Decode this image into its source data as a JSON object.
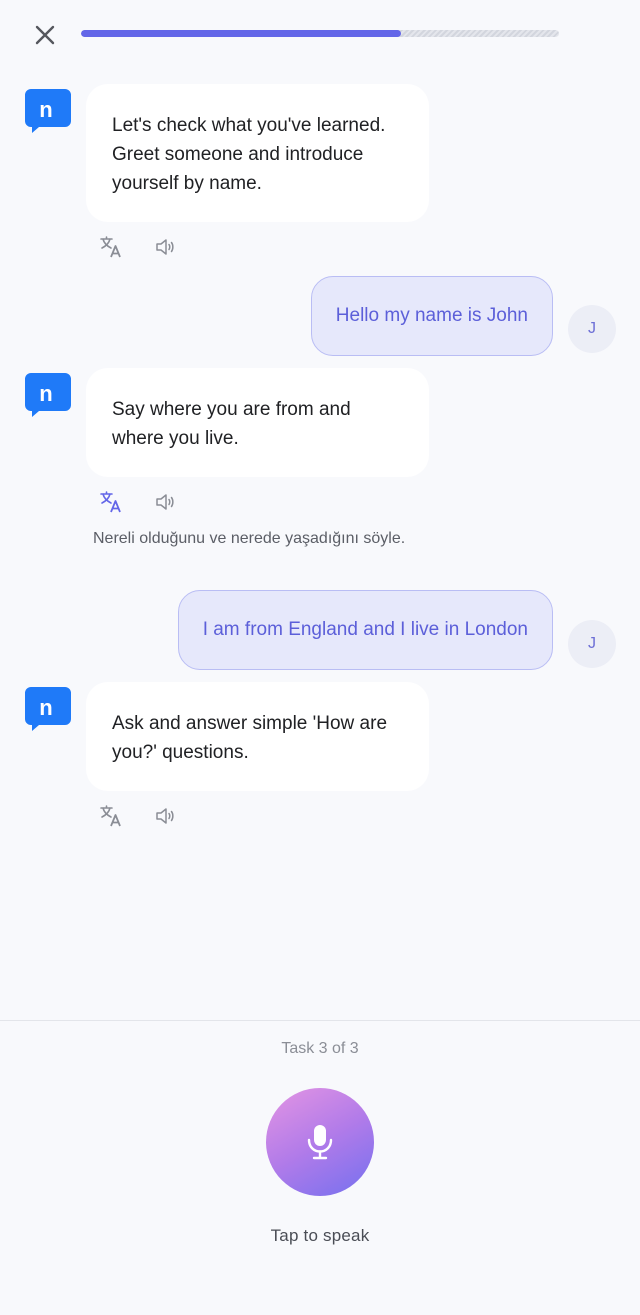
{
  "header": {
    "close_icon": "close-icon",
    "progress": 0.67
  },
  "conversation": {
    "bot_messages": [
      {
        "text": "Let's check what you've learned. Greet someone and introduce yourself by name.",
        "avatar_letter": "n",
        "translation": ""
      },
      {
        "text": "Say where you are from and where you live.",
        "avatar_letter": "n",
        "translation": "Nereli olduğunu ve nerede yaşadığını söyle."
      },
      {
        "text": "Ask and answer simple 'How are you?' questions.",
        "avatar_letter": "n",
        "translation": ""
      }
    ],
    "user_messages": [
      {
        "text": "Hello my name is John",
        "avatar_letter": "J"
      },
      {
        "text": "I am from England and I live in London",
        "avatar_letter": "J"
      }
    ]
  },
  "footer": {
    "task_count": "Task 3 of 3",
    "mic_icon": "microphone-icon",
    "tap_label": "Tap to speak"
  },
  "colors": {
    "accent": "#6366e8",
    "brand_blue": "#1f7af8",
    "user_bubble": "#e6e8fb",
    "user_text": "#5c5fd9",
    "background": "#f8f9fc"
  }
}
